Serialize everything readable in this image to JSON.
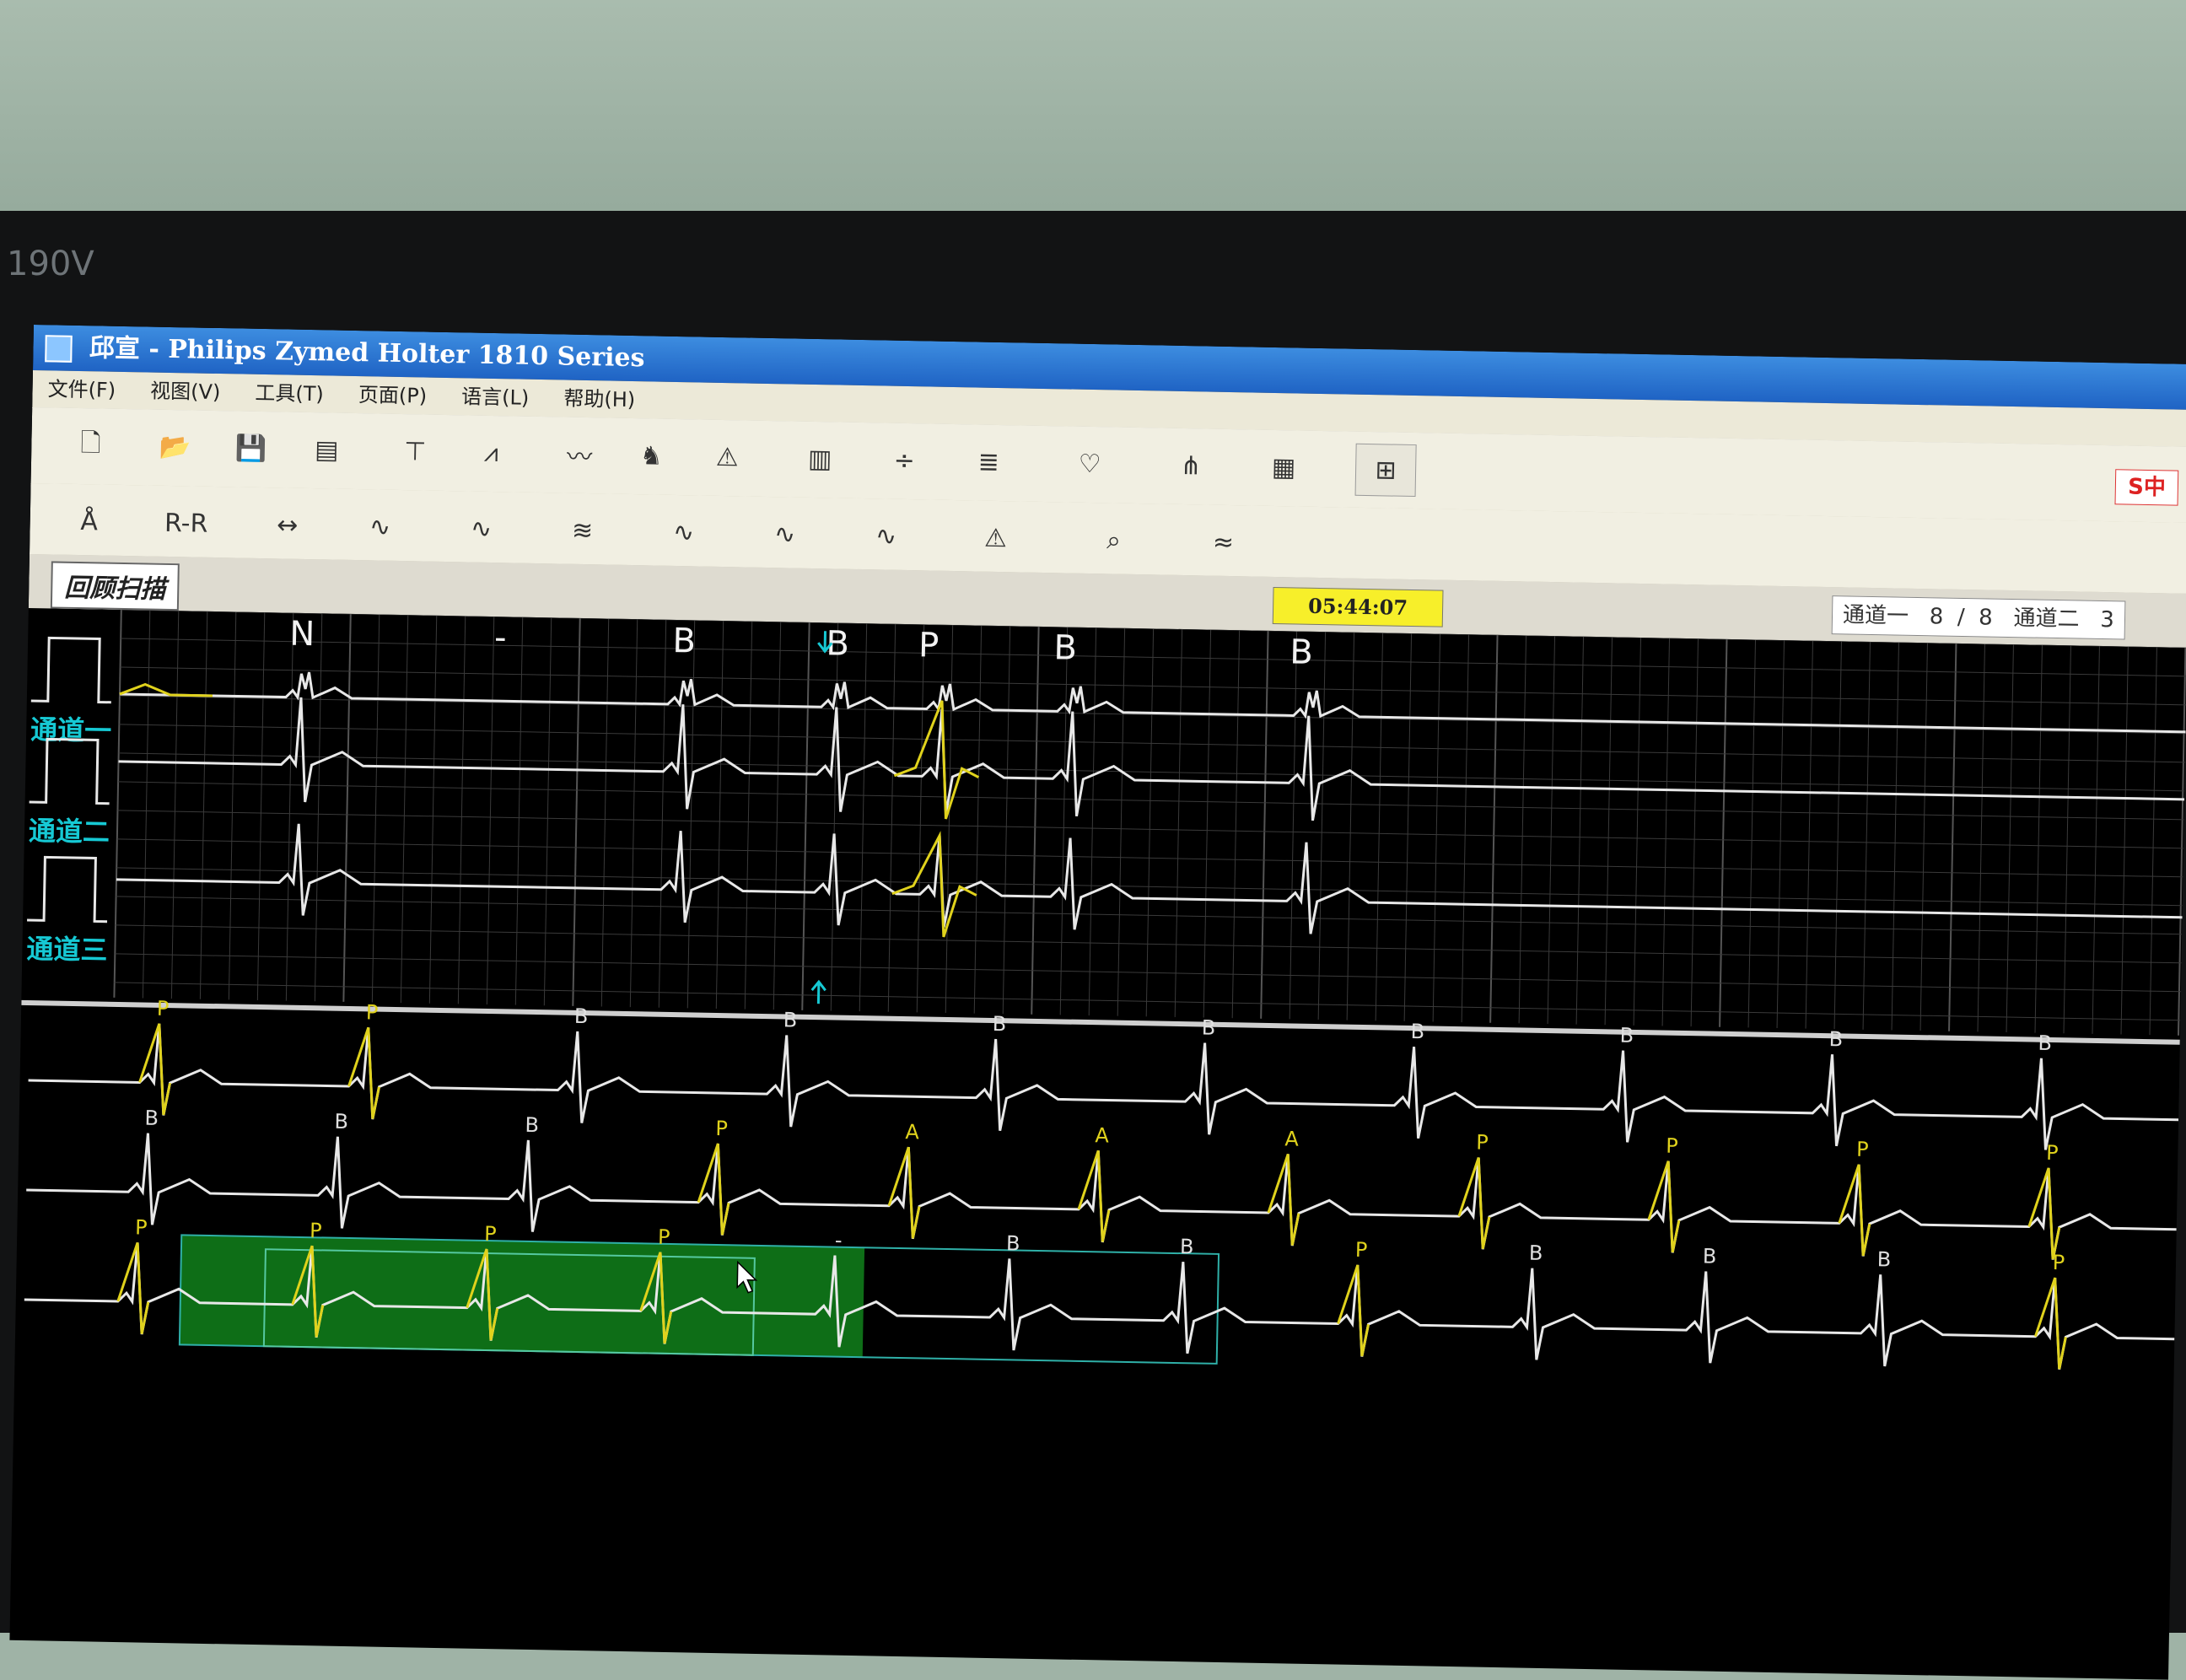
{
  "monitor": {
    "model": "190V"
  },
  "app": {
    "title": "邱宣 - Philips Zymed Holter 1810 Series"
  },
  "menu": [
    {
      "label": "文件(F)"
    },
    {
      "label": "视图(V)"
    },
    {
      "label": "工具(T)"
    },
    {
      "label": "页面(P)"
    },
    {
      "label": "语言(L)"
    },
    {
      "label": "帮助(H)"
    }
  ],
  "toolbar1": [
    {
      "name": "new-icon",
      "glyph": "🗋"
    },
    {
      "name": "open-folder-icon",
      "glyph": "📂"
    },
    {
      "name": "save-icon",
      "glyph": "💾"
    },
    {
      "name": "print-icon",
      "glyph": "▤"
    },
    {
      "name": "st-analysis-icon",
      "glyph": "⊤"
    },
    {
      "name": "beat-compare-icon",
      "glyph": "⩘"
    },
    {
      "name": "ecg-wave-icon",
      "glyph": "〰"
    },
    {
      "name": "people-icon",
      "glyph": "♞"
    },
    {
      "name": "warning-wave-icon",
      "glyph": "⚠"
    },
    {
      "name": "histogram-icon",
      "glyph": "▥"
    },
    {
      "name": "beat-divide-icon",
      "glyph": "÷"
    },
    {
      "name": "full-disclosure-icon",
      "glyph": "≣"
    },
    {
      "name": "heart-icon",
      "glyph": "♡"
    },
    {
      "name": "pacer-icon",
      "glyph": "⋔"
    },
    {
      "name": "report-icon",
      "glyph": "▦"
    },
    {
      "name": "grid-icon",
      "glyph": "⊞"
    }
  ],
  "toolbar2": [
    {
      "name": "font-a-icon",
      "glyph": "Å"
    },
    {
      "name": "rr-interval-icon",
      "glyph": "R-R"
    },
    {
      "name": "beat-measure-icon",
      "glyph": "↔"
    },
    {
      "name": "normal-beat-icon",
      "glyph": "∿"
    },
    {
      "name": "ventricular-beat-icon",
      "glyph": "∿"
    },
    {
      "name": "noise-beat-icon",
      "glyph": "≋"
    },
    {
      "name": "supraventricular-beat-icon",
      "glyph": "∿"
    },
    {
      "name": "pause-beat-icon",
      "glyph": "∿"
    },
    {
      "name": "paced-beat-icon",
      "glyph": "∿"
    },
    {
      "name": "alarm-beat-icon",
      "glyph": "⚠"
    },
    {
      "name": "zoom-wave-icon",
      "glyph": "⌕"
    },
    {
      "name": "twelve-lead-icon",
      "glyph": "≈"
    }
  ],
  "ime": {
    "label": "S中"
  },
  "status": {
    "mode_label": "回顾扫描",
    "time": "05:44:07",
    "channels": "通道一   8  /  8   通道二   3"
  },
  "channels": [
    {
      "label": "通道一"
    },
    {
      "label": "通道二"
    },
    {
      "label": "通道三"
    }
  ],
  "colors": {
    "normal_trace": "#e8e8e8",
    "highlight_trace": "#e0d21c",
    "channel_label": "#16c9d4",
    "grid": "#3a3a3a",
    "selection": "#0f7a1a"
  },
  "beat_labels": [
    "N",
    "-",
    "B",
    "B",
    "P",
    "B",
    "B"
  ],
  "strip_rows": [
    {
      "labels": [
        "P",
        "P",
        "B",
        "B",
        "B",
        "B",
        "B",
        "B",
        "B",
        "B"
      ]
    },
    {
      "labels": [
        "B",
        "B",
        "B",
        "P",
        "A",
        "A",
        "A",
        "P",
        "P",
        "P",
        "P"
      ]
    },
    {
      "labels": [
        "P",
        "P",
        "P",
        "P",
        "-",
        "B",
        "B",
        "P",
        "B",
        "B",
        "B",
        "P"
      ]
    }
  ]
}
